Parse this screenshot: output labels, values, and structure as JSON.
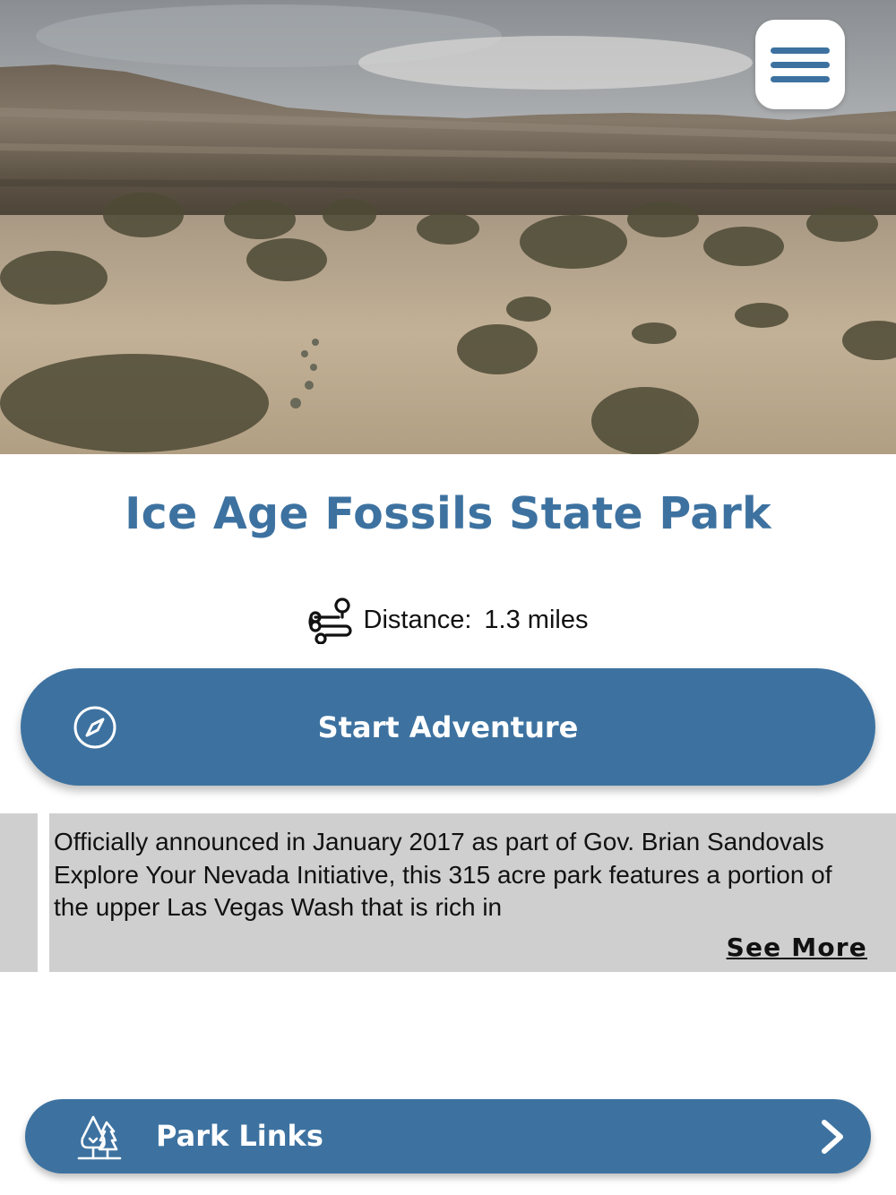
{
  "hero": {
    "image_alt": "Desert landscape with eroded cliffs and creosote bushes",
    "menu_icon": "hamburger-menu-icon"
  },
  "park": {
    "title": "Ice Age Fossils State Park",
    "distance_label": "Distance:",
    "distance_value": "1.3 miles",
    "distance_icon": "route-icon"
  },
  "start_button": {
    "label": "Start Adventure",
    "icon": "compass-icon"
  },
  "description": {
    "text": "Officially announced in January 2017 as part of Gov. Brian Sandovals Explore Your Nevada Initiative, this 315 acre park features a portion of the upper Las Vegas Wash that is rich in",
    "see_more_label": "See More"
  },
  "park_links": {
    "label": "Park Links",
    "icon": "trees-icon",
    "chevron_icon": "chevron-right-icon"
  },
  "colors": {
    "accent": "#3d72a0",
    "description_bg": "#cfcfcf"
  }
}
